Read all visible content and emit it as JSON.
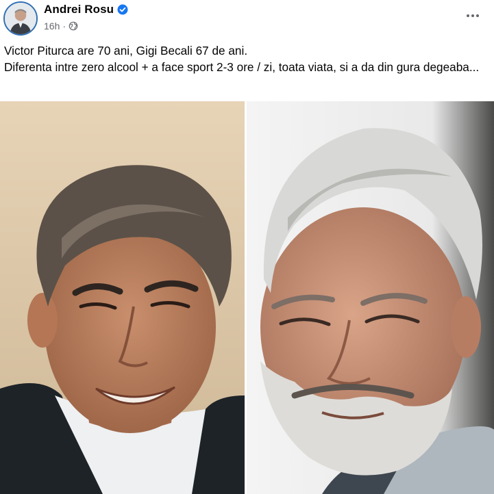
{
  "post": {
    "author": {
      "name": "Andrei Rosu",
      "verified_icon": "verified-badge-icon",
      "badge_color": "#1877f2"
    },
    "meta": {
      "timestamp": "16h",
      "separator": "·",
      "audience_icon": "globe-icon"
    },
    "more_icon": "more-options-icon",
    "text_lines": [
      "Victor Piturca are 70 ani, Gigi Becali 67 de ani.",
      "Diferenta intre zero alcool + a face sport 2-3 ore / zi, toata viata, si a da din gura degeaba..."
    ],
    "media": {
      "images": [
        {
          "subject": "portrait-photo-smiling-man-dark-hair"
        },
        {
          "subject": "portrait-photo-older-man-grey-beard"
        }
      ]
    }
  },
  "colors": {
    "text_primary": "#050505",
    "text_secondary": "#65676b",
    "accent": "#1877f2"
  }
}
